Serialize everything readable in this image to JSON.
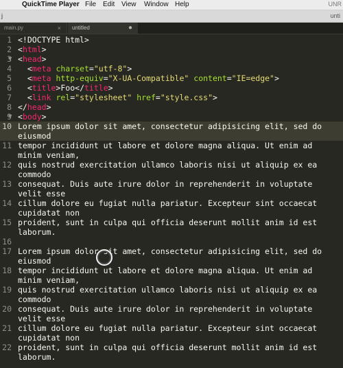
{
  "menubar": {
    "apple_icon": "apple-icon",
    "items": [
      "QuickTime Player",
      "File",
      "Edit",
      "View",
      "Window",
      "Help"
    ],
    "right_text": "UNR"
  },
  "toolbar": {
    "left_mark": "j",
    "right_text": "unti"
  },
  "tabs": [
    {
      "label": "main.py",
      "close_icon": "×"
    },
    {
      "label": "untitled",
      "dirty_icon": "●"
    }
  ],
  "gutter": {
    "numbers": [
      "1",
      "2",
      "3",
      "4",
      "5",
      "6",
      "7",
      "8",
      "9",
      "10",
      "11",
      "12",
      "13",
      "14",
      "15",
      "16",
      "17",
      "18",
      "19",
      "20",
      "21",
      "22"
    ],
    "fold_arrow": "▼"
  },
  "code": {
    "doctype": "<!DOCTYPE html>",
    "tags": {
      "html": "html",
      "head": "head",
      "meta": "meta",
      "title": "title",
      "link": "link",
      "body": "body"
    },
    "attrs": {
      "charset": "charset",
      "http_equiv": "http-equiv",
      "content": "content",
      "rel": "rel",
      "href": "href"
    },
    "values": {
      "utf8": "\"utf-8\"",
      "xua": "\"X-UA-Compatible\"",
      "ie": "\"IE=edge\"",
      "stylesheet": "\"stylesheet\"",
      "css": "\"style.css\""
    },
    "title_text": "Foo",
    "p1": [
      [
        "Lorem ipsum dolor sit amet, consectetur adipisicing elit, sed do",
        "eiusmod"
      ],
      [
        "tempor incididunt ut labore et dolore magna aliqua. Ut enim ad",
        "minim veniam,"
      ],
      [
        "quis nostrud exercitation ullamco laboris nisi ut aliquip ex ea",
        "commodo"
      ],
      [
        "consequat. Duis aute irure dolor in reprehenderit in voluptate",
        "velit esse"
      ],
      [
        "cillum dolore eu fugiat nulla pariatur. Excepteur sint occaecat",
        "cupidatat non"
      ],
      [
        "proident, sunt in culpa qui officia deserunt mollit anim id est",
        "laborum."
      ]
    ],
    "p2": [
      [
        "Lorem ipsum dolor sit amet, consectetur adipisicing elit, sed do",
        "eiusmod"
      ],
      [
        "tempor incididunt ut labore et dolore magna aliqua. Ut enim ad",
        "minim veniam,"
      ],
      [
        "quis nostrud exercitation ullamco laboris nisi ut aliquip ex ea",
        "commodo"
      ],
      [
        "consequat. Duis aute irure dolor in reprehenderit in voluptate",
        "velit esse"
      ],
      [
        "cillum dolore eu fugiat nulla pariatur. Excepteur sint occaecat",
        "cupidatat non"
      ],
      [
        "proident, sunt in culpa qui officia deserunt mollit anim id est",
        "laborum."
      ]
    ]
  },
  "colors": {
    "background": "#272822",
    "tag": "#f92672",
    "attribute": "#a6e22e",
    "string": "#e6db74",
    "text": "#f8f8f2"
  }
}
